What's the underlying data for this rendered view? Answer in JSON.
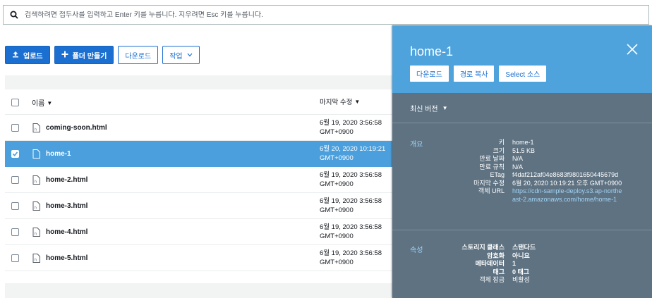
{
  "search": {
    "placeholder": "검색하려면 접두사를 입력하고 Enter 키를 누릅니다. 지우려면 Esc 키를 누릅니다."
  },
  "toolbar": {
    "upload_label": "업로드",
    "create_folder_label": "폴더 만들기",
    "download_label": "다운로드",
    "actions_label": "작업"
  },
  "table": {
    "col_name": "이름",
    "col_modified": "마지막 수정",
    "rows": [
      {
        "name": "coming-soon.html",
        "modified": "6월 19, 2020 3:56:58\nGMT+0900"
      },
      {
        "name": "home-1",
        "modified": "6월 20, 2020 10:19:21\nGMT+0900"
      },
      {
        "name": "home-2.html",
        "modified": "6월 19, 2020 3:56:58\nGMT+0900"
      },
      {
        "name": "home-3.html",
        "modified": "6월 19, 2020 3:56:58\nGMT+0900"
      },
      {
        "name": "home-4.html",
        "modified": "6월 19, 2020 3:56:58\nGMT+0900"
      },
      {
        "name": "home-5.html",
        "modified": "6월 19, 2020 3:56:58\nGMT+0900"
      }
    ]
  },
  "panel": {
    "title": "home-1",
    "buttons": {
      "download": "다운로드",
      "copy_path": "경로 복사",
      "select": "Select 소스"
    },
    "version_label": "최신 버전",
    "overview": {
      "label": "개요",
      "items": [
        {
          "k": "키",
          "v": "home-1"
        },
        {
          "k": "크기",
          "v": "51.5 KB"
        },
        {
          "k": "만료 날짜",
          "v": "N/A"
        },
        {
          "k": "만료 규칙",
          "v": "N/A"
        },
        {
          "k": "ETag",
          "v": "f4daf212af04e8683f9801650445679d"
        },
        {
          "k": "마지막 수정",
          "v": "6월 20, 2020 10:19:21 오후 GMT+0900"
        },
        {
          "k": "객체 URL",
          "v": "https://cdn-sample-deploy.s3.ap-northeast-2.amazonaws.com/home/home-1"
        }
      ]
    },
    "properties": {
      "label": "속성",
      "items": [
        {
          "k": "스토리지 클래스",
          "v": "스탠다드"
        },
        {
          "k": "암호화",
          "v": "아니요"
        },
        {
          "k": "메타데이터",
          "v": "1"
        },
        {
          "k": "태그",
          "v": "0 태그"
        },
        {
          "k": "객체 잠금",
          "v": "비활성"
        }
      ]
    }
  },
  "colors": {
    "primary": "#1b6fd0",
    "selected_row": "#4a9fdc",
    "panel_header": "#4fa3dc",
    "panel_body": "#5e7282"
  }
}
